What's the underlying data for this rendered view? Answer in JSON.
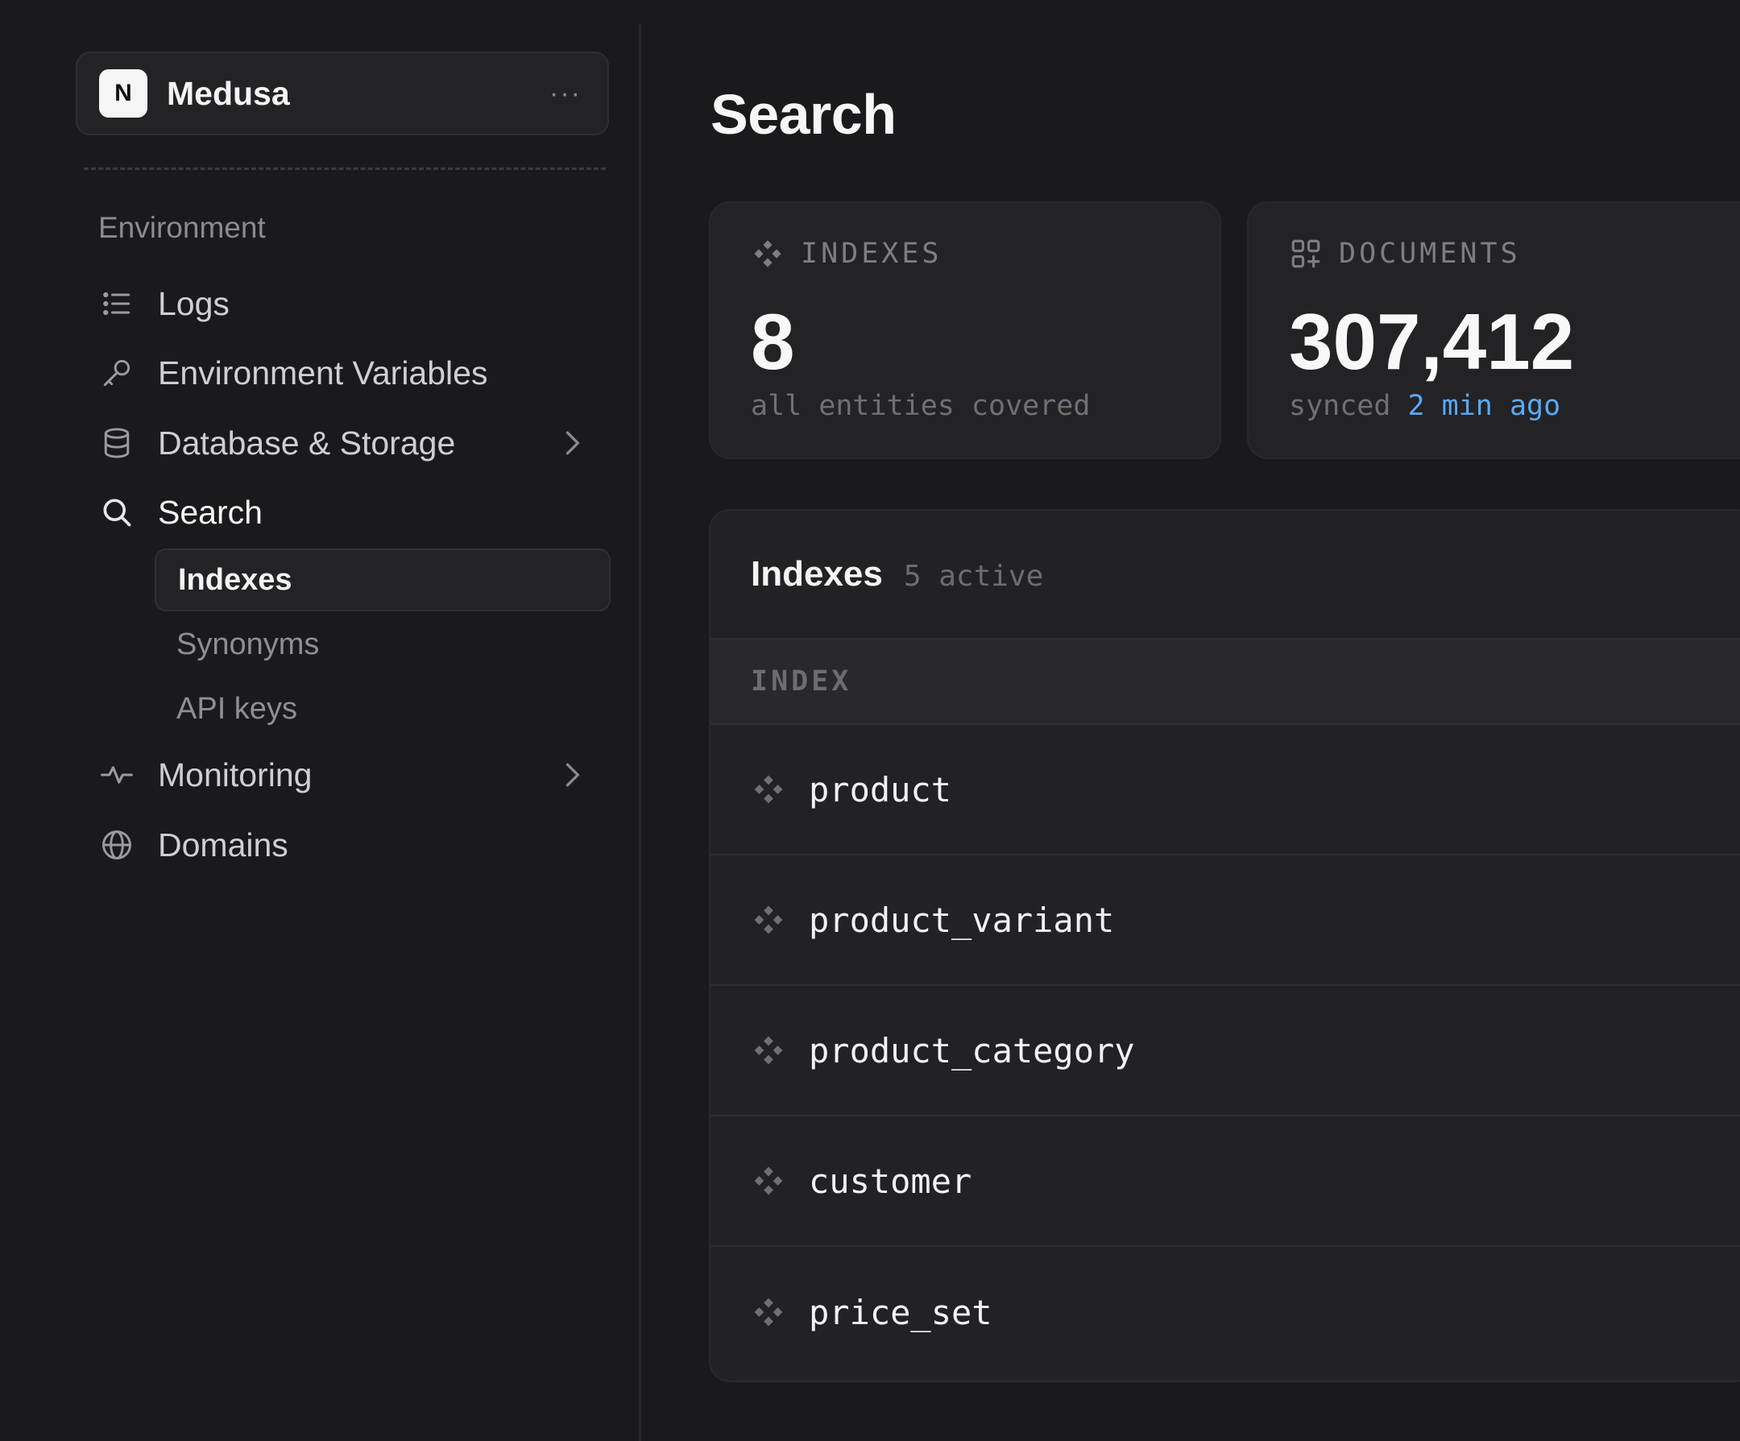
{
  "org": {
    "avatar_letter": "N",
    "name": "Medusa",
    "more_label": "···"
  },
  "sidebar": {
    "section_label": "Environment",
    "items": [
      {
        "label": "Logs",
        "icon": "list-icon"
      },
      {
        "label": "Environment Variables",
        "icon": "key-icon"
      },
      {
        "label": "Database & Storage",
        "icon": "database-icon",
        "has_chevron": true
      },
      {
        "label": "Search",
        "icon": "search-icon",
        "active": true,
        "subitems": [
          {
            "label": "Indexes",
            "selected": true
          },
          {
            "label": "Synonyms"
          },
          {
            "label": "API keys"
          }
        ]
      },
      {
        "label": "Monitoring",
        "icon": "activity-icon",
        "has_chevron": true
      },
      {
        "label": "Domains",
        "icon": "globe-icon"
      }
    ]
  },
  "main": {
    "title": "Search",
    "stats": [
      {
        "label": "INDEXES",
        "value": "8",
        "sub": "all entities covered",
        "icon": "index-icon"
      },
      {
        "label": "DOCUMENTS",
        "value": "307,412",
        "sub_prefix": "synced",
        "sub_accent": "2 min ago",
        "icon": "grid-plus-icon"
      }
    ],
    "table": {
      "title": "Indexes",
      "count": "5 active",
      "column": "INDEX",
      "rows": [
        "product",
        "product_variant",
        "product_category",
        "customer",
        "price_set"
      ]
    }
  },
  "colors": {
    "background": "#1a1a1c",
    "card": "#232326",
    "accent": "#5aa9f6"
  }
}
